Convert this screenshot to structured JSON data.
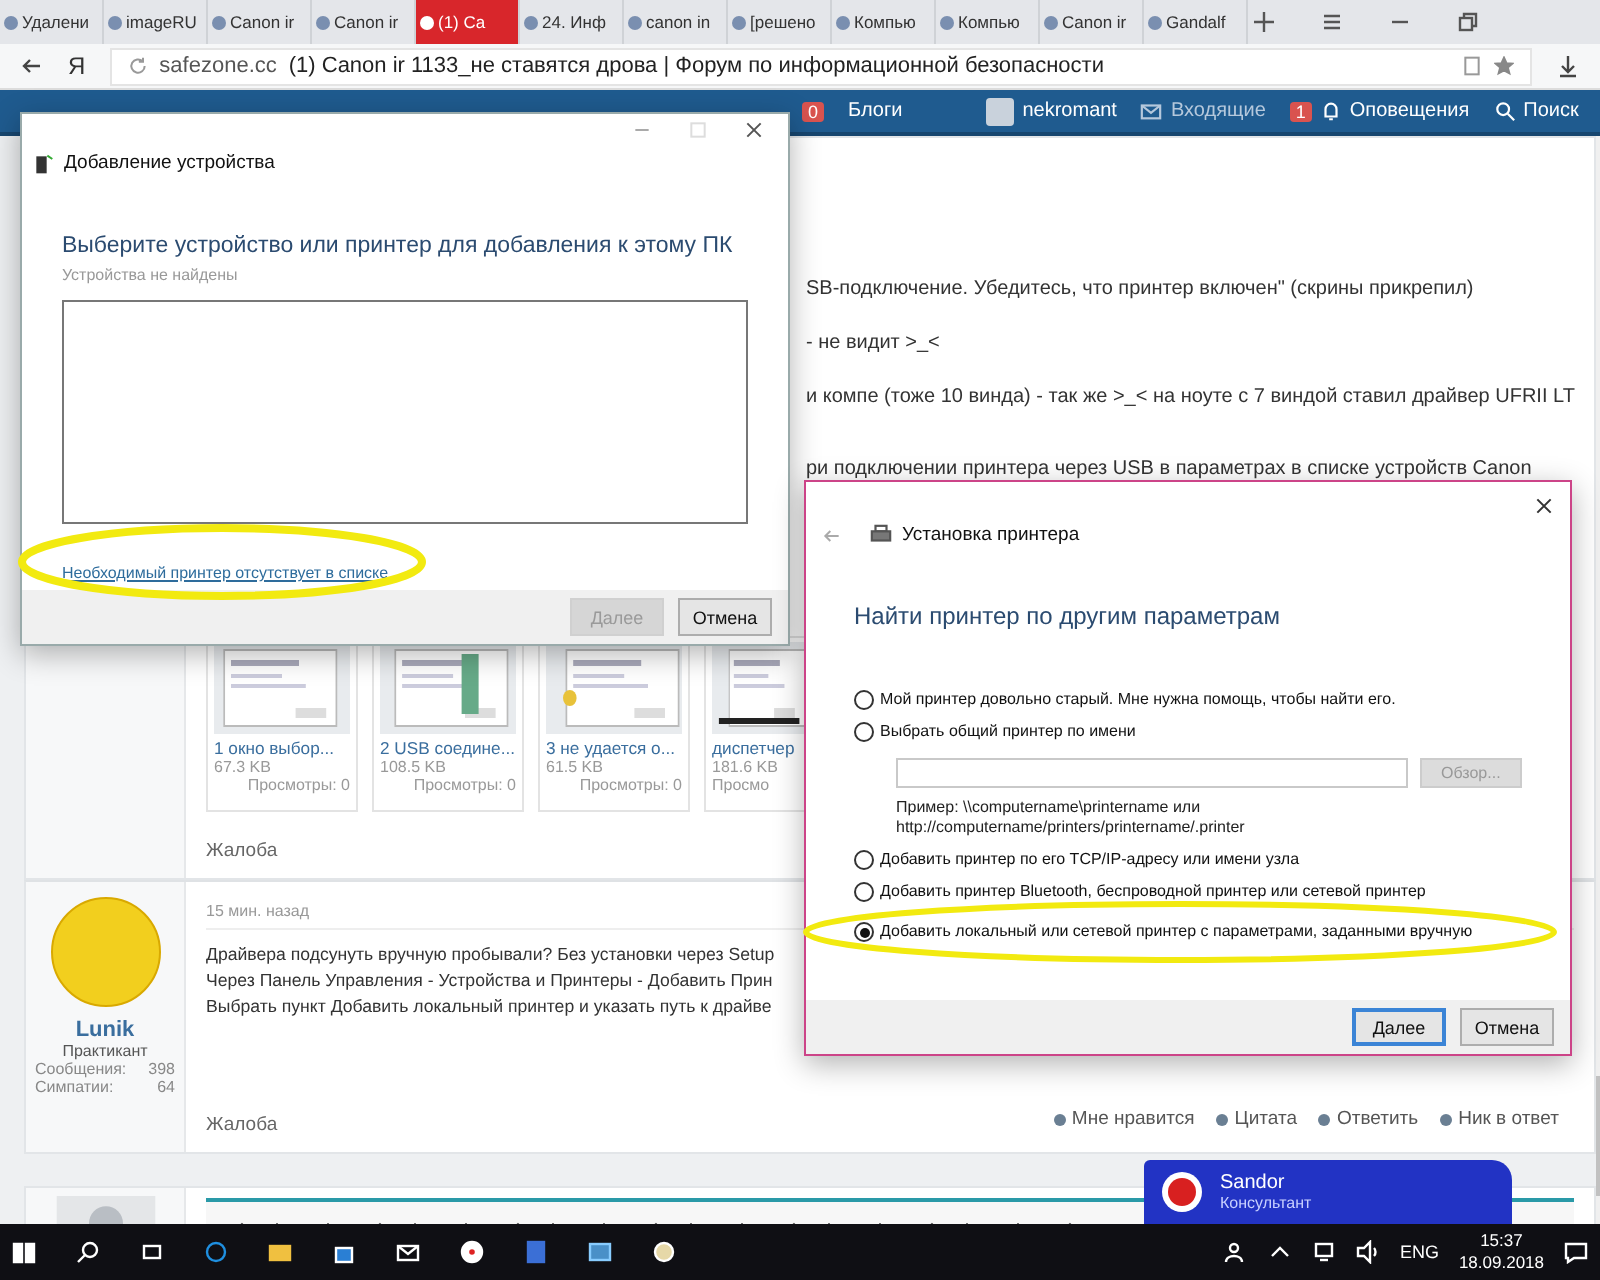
{
  "browser": {
    "tabs": [
      {
        "label": "Удалени",
        "selected": false
      },
      {
        "label": "imageRU",
        "selected": false
      },
      {
        "label": "Canon ir",
        "selected": false
      },
      {
        "label": "Canon ir",
        "selected": false
      },
      {
        "label": "(1) Ca",
        "selected": true
      },
      {
        "label": "24. Инф",
        "selected": false
      },
      {
        "label": "canon in",
        "selected": false
      },
      {
        "label": "[решено",
        "selected": false
      },
      {
        "label": "Компью",
        "selected": false
      },
      {
        "label": "Компью",
        "selected": false
      },
      {
        "label": "Canon ir",
        "selected": false
      },
      {
        "label": "Gandalf",
        "selected": false
      }
    ],
    "home_button": "Я",
    "domain": "safezone.cc",
    "page_title": "(1) Canon ir 1133_не ставятся дрова | Форум по информационной безопасности"
  },
  "forum_nav": {
    "badge": "0",
    "blogs": "Блоги",
    "user": "nekromant",
    "inbox": "Входящие",
    "alerts_count": "1",
    "alerts": "Оповещения",
    "search": "Поиск"
  },
  "post1": {
    "lines": [
      "SB-подключение. Убедитесь, что принтер включен\" (скрины прикрепил)",
      "- не видит >_<",
      "и компе (тоже 10 винда) - так же >_< на ноуте с 7 виндой ставил драйвер UFRII LT",
      "ри подключении принтера через USB в параметрах в списке устройств Canon"
    ],
    "attachments": [
      {
        "name": "1 окно выбор...",
        "size": "67.3 KB",
        "views": "Просмотры: 0"
      },
      {
        "name": "2 USB соедине...",
        "size": "108.5 KB",
        "views": "Просмотры: 0"
      },
      {
        "name": "3 не удается о...",
        "size": "61.5 KB",
        "views": "Просмотры: 0"
      },
      {
        "name": "диспетчер",
        "size": "181.6 KB",
        "views": "Просмо"
      }
    ],
    "report": "Жалоба"
  },
  "post2": {
    "author": "Lunik",
    "role": "Практикант",
    "stats": [
      {
        "label": "Сообщения:",
        "value": "398"
      },
      {
        "label": "Симпатии:",
        "value": "64"
      }
    ],
    "time": "15 мин. назад",
    "lines": [
      "Драйвера подсунуть вручную пробывали? Без установки через Setup",
      "Через Панель Управления - Устройства и Принтеры - Добавить Прин",
      "Выбрать пункт Добавить локальный принтер и указать путь к драйве"
    ],
    "report": "Жалоба",
    "actions": [
      "Мне нравится",
      "Цитата",
      "Ответить",
      "Ник в ответ"
    ]
  },
  "chat_widget": {
    "name": "Sandor",
    "role": "Консультант"
  },
  "taskbar": {
    "language": "ENG",
    "time": "15:37",
    "date": "18.09.2018"
  },
  "add_device_dialog": {
    "title": "Добавление устройства",
    "heading": "Выберите устройство или принтер для добавления к этому ПК",
    "status": "Устройства не найдены",
    "link": "Необходимый принтер отсутствует в списке",
    "buttons": [
      {
        "label": "Далее",
        "disabled": true
      },
      {
        "label": "Отмена",
        "disabled": false
      }
    ]
  },
  "printer_dialog": {
    "title": "Установка принтера",
    "heading": "Найти принтер по другим параметрам",
    "options": [
      {
        "kind": "plain",
        "label": "Мой принтер довольно старый. Мне нужна помощь, чтобы найти его.",
        "selected": false
      },
      {
        "kind": "with_path",
        "label": "Выбрать общий принтер по имени",
        "selected": false,
        "browse": "Обзор...",
        "browse_disabled": true,
        "example": "Пример: \\\\computername\\printername или http://computername/printers/printername/.printer"
      },
      {
        "kind": "plain",
        "label": "Добавить принтер по его TCP/IP-адресу или имени узла",
        "selected": false
      },
      {
        "kind": "plain",
        "label": "Добавить принтер Bluetooth, беспроводной принтер или сетевой принтер",
        "selected": false
      },
      {
        "kind": "plain",
        "label": "Добавить локальный или сетевой принтер с параметрами, заданными вручную",
        "selected": true
      }
    ],
    "buttons": [
      {
        "label": "Далее",
        "disabled": false
      },
      {
        "label": "Отмена",
        "disabled": false
      }
    ]
  }
}
